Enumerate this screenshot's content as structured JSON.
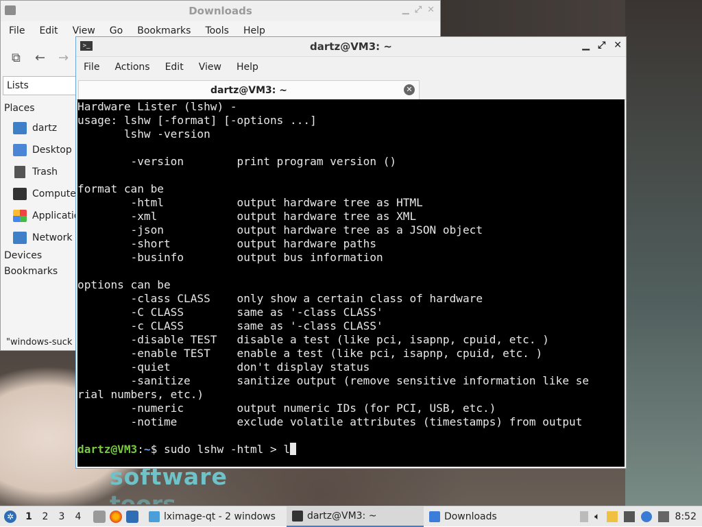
{
  "background": {
    "words": [
      "software",
      "teors"
    ]
  },
  "file_manager": {
    "title": "Downloads",
    "menu": [
      "File",
      "Edit",
      "View",
      "Go",
      "Bookmarks",
      "Tools",
      "Help"
    ],
    "side_view_selector": "Lists",
    "places_label": "Places",
    "places": [
      {
        "label": "dartz",
        "icon": "home-folder-icon"
      },
      {
        "label": "Desktop",
        "icon": "desktop-icon"
      },
      {
        "label": "Trash",
        "icon": "trash-icon"
      },
      {
        "label": "Compute",
        "icon": "computer-icon"
      },
      {
        "label": "Applicatio",
        "icon": "applications-icon"
      },
      {
        "label": "Network",
        "icon": "network-icon"
      }
    ],
    "devices_label": "Devices",
    "bookmarks_label": "Bookmarks",
    "status_text": "\"windows-suck"
  },
  "terminal": {
    "title": "dartz@VM3: ~",
    "menu": [
      "File",
      "Actions",
      "Edit",
      "View",
      "Help"
    ],
    "tab_label": "dartz@VM3: ~",
    "output": [
      "Hardware Lister (lshw) -",
      "usage: lshw [-format] [-options ...]",
      "       lshw -version",
      "",
      "        -version        print program version ()",
      "",
      "format can be",
      "        -html           output hardware tree as HTML",
      "        -xml            output hardware tree as XML",
      "        -json           output hardware tree as a JSON object",
      "        -short          output hardware paths",
      "        -businfo        output bus information",
      "",
      "options can be",
      "        -class CLASS    only show a certain class of hardware",
      "        -C CLASS        same as '-class CLASS'",
      "        -c CLASS        same as '-class CLASS'",
      "        -disable TEST   disable a test (like pci, isapnp, cpuid, etc. )",
      "        -enable TEST    enable a test (like pci, isapnp, cpuid, etc. )",
      "        -quiet          don't display status",
      "        -sanitize       sanitize output (remove sensitive information like se",
      "rial numbers, etc.)",
      "        -numeric        output numeric IDs (for PCI, USB, etc.)",
      "        -notime         exclude volatile attributes (timestamps) from output",
      ""
    ],
    "prompt_user": "dartz@VM3",
    "prompt_sep": ":",
    "prompt_path": "~",
    "prompt_symbol": "$ ",
    "command": "sudo lshw -html > l"
  },
  "taskbar": {
    "workspaces": [
      "1",
      "2",
      "3",
      "4"
    ],
    "tasks": [
      {
        "label": "lximage-qt - 2 windows",
        "icon": "image-viewer-icon",
        "color": "#4a9fd8"
      },
      {
        "label": "dartz@VM3: ~",
        "icon": "terminal-icon",
        "color": "#333333",
        "active": true
      },
      {
        "label": "Downloads",
        "icon": "folder-icon",
        "color": "#3b7dd8"
      }
    ],
    "clock": "8:52"
  }
}
